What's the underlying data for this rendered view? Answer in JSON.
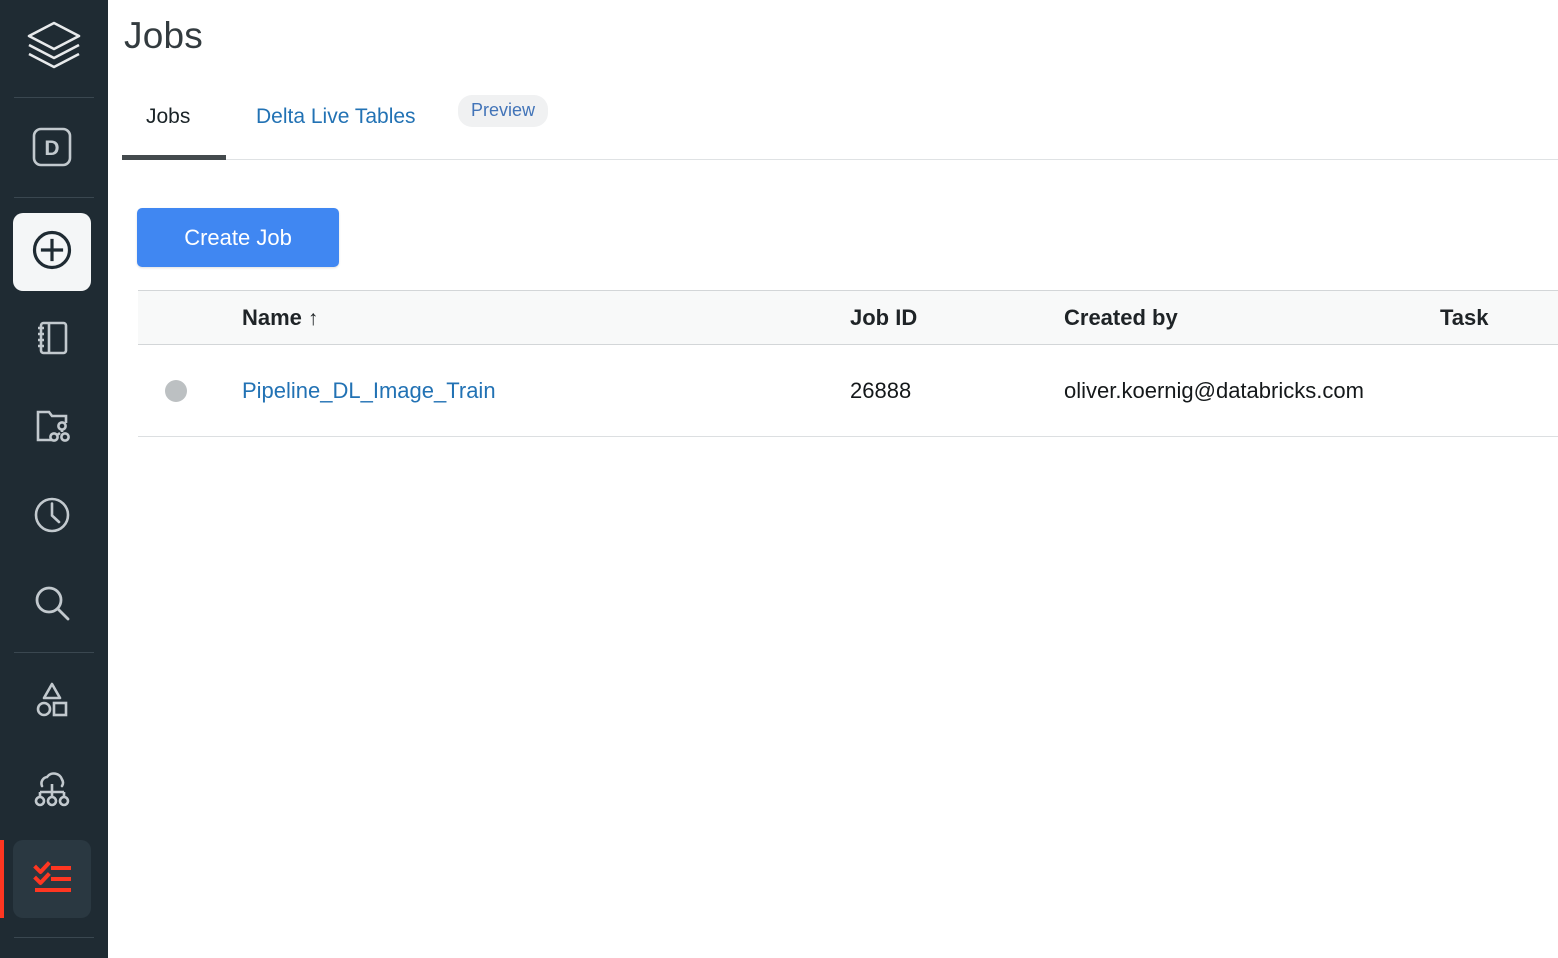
{
  "sidebar": {
    "logo_icon": "databricks-logo-icon",
    "items": [
      {
        "icon": "workspace-d-icon",
        "name": "sidebar-item-workspace-d",
        "active": false
      },
      {
        "icon": "plus-circle-icon",
        "name": "sidebar-item-new",
        "active": true
      },
      {
        "icon": "notebook-icon",
        "name": "sidebar-item-workspace",
        "active": false
      },
      {
        "icon": "repos-folder-icon",
        "name": "sidebar-item-repos",
        "active": false
      },
      {
        "icon": "clock-icon",
        "name": "sidebar-item-recents",
        "active": false
      },
      {
        "icon": "search-icon",
        "name": "sidebar-item-search",
        "active": false
      },
      {
        "icon": "shapes-data-icon",
        "name": "sidebar-item-data",
        "active": false
      },
      {
        "icon": "compute-cloud-icon",
        "name": "sidebar-item-compute",
        "active": false
      },
      {
        "icon": "jobs-checklist-icon",
        "name": "sidebar-item-jobs",
        "active": true
      }
    ]
  },
  "header": {
    "title": "Jobs"
  },
  "tabs": {
    "jobs_label": "Jobs",
    "dlt_label": "Delta Live Tables",
    "preview_badge": "Preview",
    "selected": "Jobs"
  },
  "toolbar": {
    "create_job_label": "Create Job"
  },
  "table": {
    "columns": [
      "",
      "Name",
      "Job ID",
      "Created by",
      "Task"
    ],
    "sort_column": "Name",
    "sort_arrow": "↑",
    "rows": [
      {
        "status": "idle",
        "name": "Pipeline_DL_Image_Train",
        "job_id": "26888",
        "created_by": "oliver.koernig@databricks.com",
        "task": ""
      }
    ]
  },
  "colors": {
    "sidebar_bg": "#1f2b33",
    "accent_red": "#ff3621",
    "primary_blue": "#4087f2",
    "link_blue": "#2272b4",
    "status_dot": "#bcc0c2"
  }
}
